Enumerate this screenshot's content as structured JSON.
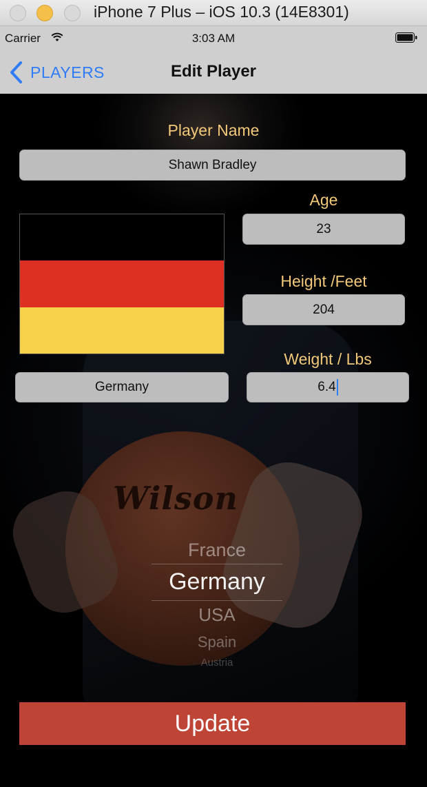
{
  "window": {
    "title": "iPhone 7 Plus – iOS 10.3 (14E8301)"
  },
  "status_bar": {
    "carrier": "Carrier",
    "time": "3:03 AM"
  },
  "nav": {
    "back_label": "PLAYERS",
    "title": "Edit Player"
  },
  "form": {
    "name_label": "Player Name",
    "name_value": "Shawn Bradley",
    "age_label": "Age",
    "age_value": "23",
    "height_label": "Height /Feet",
    "height_value": "204",
    "weight_label": "Weight / Lbs",
    "weight_value": "6.4",
    "country_value": "Germany",
    "flag_colors": [
      "#000000",
      "#dd2f22",
      "#f7d149"
    ]
  },
  "picker": {
    "items": [
      "France",
      "Germany",
      "USA",
      "Spain",
      "Austria"
    ],
    "selected": "Germany"
  },
  "background": {
    "ball_text": "Wilson"
  },
  "actions": {
    "update_label": "Update"
  },
  "colors": {
    "accent": "#2e7cf6",
    "label": "#f2c879",
    "update_button": "#be4535"
  }
}
